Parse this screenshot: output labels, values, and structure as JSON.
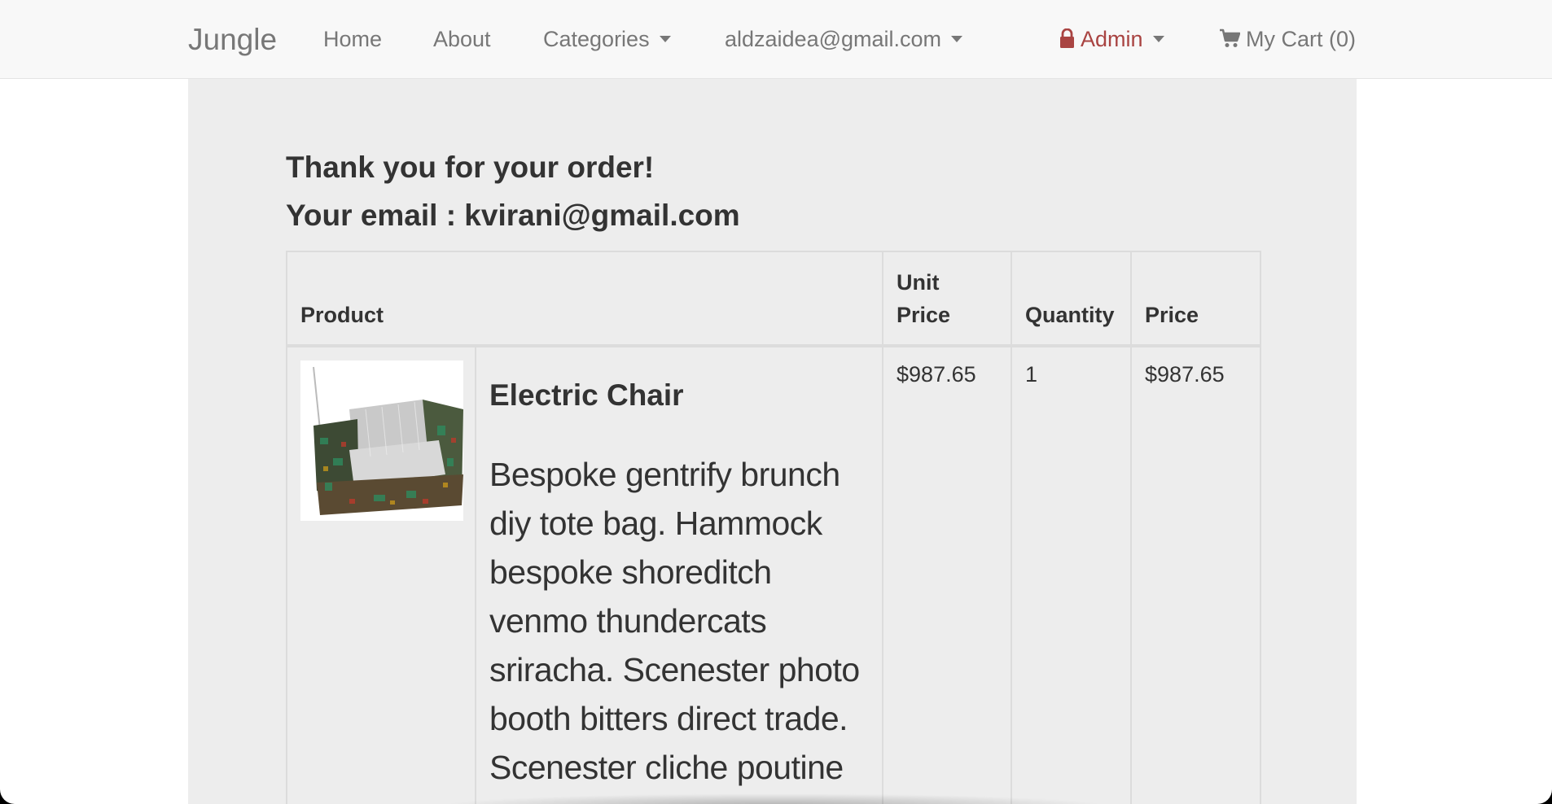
{
  "navbar": {
    "brand": "Jungle",
    "home": "Home",
    "about": "About",
    "categories": "Categories",
    "user_email": "aldzaidea@gmail.com",
    "admin": "Admin",
    "cart": "My Cart (0)"
  },
  "order": {
    "thanks": "Thank you for your order!",
    "email_line": "Your email : kvirani@gmail.com",
    "table": {
      "headers": {
        "product": "Product",
        "unit_price": "Unit Price",
        "quantity": "Quantity",
        "price": "Price"
      },
      "rows": [
        {
          "name": "Electric Chair",
          "description": "Bespoke gentrify brunch diy tote bag. Hammock bespoke shoreditch venmo thundercats sriracha. Scenester photo booth bitters direct trade. Scenester cliche poutine",
          "unit_price": "$987.65",
          "quantity": "1",
          "price": "$987.65"
        }
      ]
    }
  },
  "colors": {
    "admin": "#a94442",
    "nav_text": "#777777",
    "main_bg": "#ededed"
  },
  "icons": [
    "lock-icon",
    "cart-icon",
    "caret-down-icon"
  ]
}
